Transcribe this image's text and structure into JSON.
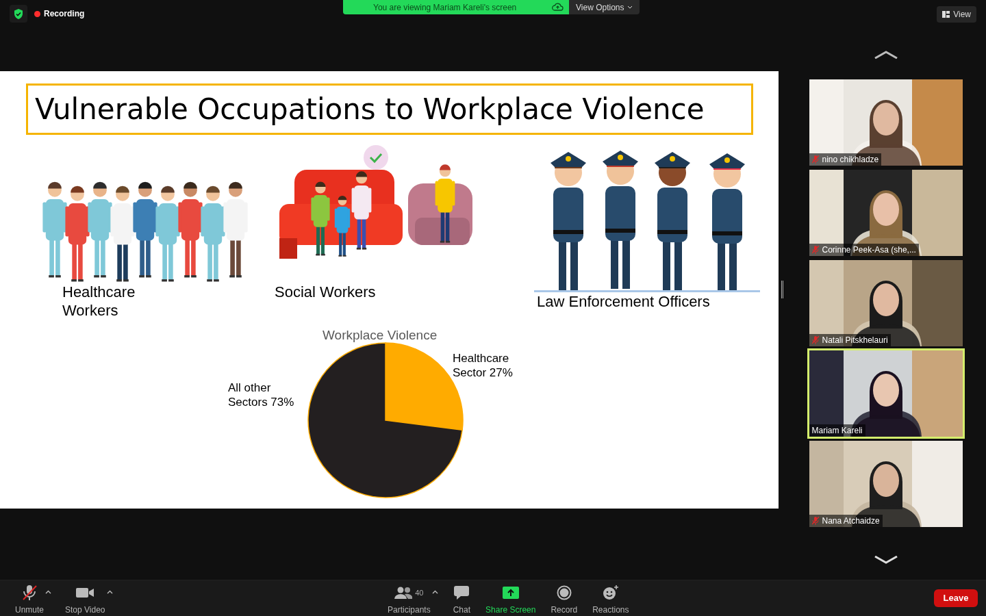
{
  "top_bar": {
    "recording": "Recording",
    "banner": "You are viewing Mariam Kareli's screen",
    "view_options": "View Options",
    "view": "View"
  },
  "slide": {
    "title": "Vulnerable Occupations to Workplace Violence",
    "groups": [
      {
        "kind": "healthcare",
        "label": "Healthcare Workers"
      },
      {
        "kind": "social",
        "label": "Social Workers"
      },
      {
        "kind": "police",
        "label": "Law Enforcement Officers"
      }
    ],
    "chart_data": {
      "type": "pie",
      "title": "Workplace Violence",
      "values": [
        27,
        73
      ],
      "colors": [
        "#ffab00",
        "#231f20"
      ],
      "value_labels": [
        "Healthcare Sector 27%",
        "All other Sectors 73%"
      ]
    }
  },
  "participants": [
    {
      "name": "nino chikhladze",
      "muted": true,
      "speaking": false
    },
    {
      "name": "Corinne Peek-Asa (she,...",
      "muted": true,
      "speaking": false
    },
    {
      "name": "Natali Pitskhelauri",
      "muted": true,
      "speaking": false
    },
    {
      "name": "Mariam Kareli",
      "muted": false,
      "speaking": true
    },
    {
      "name": "Nana Atchaidze",
      "muted": true,
      "speaking": false
    }
  ],
  "toolbar": [
    {
      "kind": "mic",
      "label": "Unmute",
      "caret": true
    },
    {
      "kind": "video",
      "label": "Stop Video",
      "caret": true
    },
    {
      "kind": "participants",
      "label": "Participants",
      "count": "40",
      "caret": true
    },
    {
      "kind": "chat",
      "label": "Chat",
      "caret": false
    },
    {
      "kind": "share",
      "label": "Share Screen",
      "caret": false
    },
    {
      "kind": "record",
      "label": "Record",
      "caret": false
    },
    {
      "kind": "reactions",
      "label": "Reactions",
      "caret": false
    }
  ],
  "leave": "Leave"
}
